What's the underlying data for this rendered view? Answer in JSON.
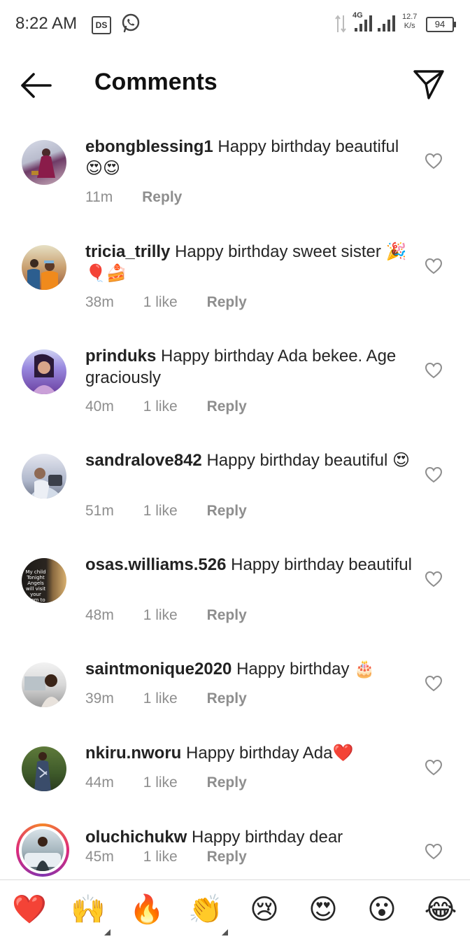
{
  "status_bar": {
    "time": "8:22 AM",
    "ds_label": "DS",
    "network": "4G",
    "speed_value": "12.7",
    "speed_unit": "K/s",
    "battery": "94"
  },
  "header": {
    "title": "Comments"
  },
  "comments": [
    {
      "username": "ebongblessing1",
      "text": "Happy birthday beautiful😍😍",
      "time": "11m",
      "likes": "",
      "reply": "Reply"
    },
    {
      "username": "tricia_trilly",
      "text": "Happy birthday sweet sister 🎉🎈🍰",
      "time": "38m",
      "likes": "1 like",
      "reply": "Reply"
    },
    {
      "username": "prinduks",
      "text": "Happy birthday Ada bekee. Age graciously",
      "time": "40m",
      "likes": "1 like",
      "reply": "Reply"
    },
    {
      "username": "sandralove842",
      "text": "Happy birthday beautiful 😍",
      "time": "51m",
      "likes": "1 like",
      "reply": "Reply"
    },
    {
      "username": "osas.williams.526",
      "text": "Happy birthday beautiful",
      "time": "48m",
      "likes": "1 like",
      "reply": "Reply"
    },
    {
      "username": "saintmonique2020",
      "text": "Happy birthday 🎂",
      "time": "39m",
      "likes": "1 like",
      "reply": "Reply"
    },
    {
      "username": "nkiru.nworu",
      "text": "Happy birthday Ada❤️",
      "time": "44m",
      "likes": "1 like",
      "reply": "Reply"
    },
    {
      "username": "oluchichukw",
      "text": "Happy birthday dear",
      "time": "45m",
      "likes": "1 like",
      "reply": "Reply"
    }
  ],
  "avatar_text": {
    "osas": "My child Tonight Angels will visit your room to bless you."
  },
  "emoji_bar": [
    "❤️",
    "🙌",
    "🔥",
    "👏",
    "😢",
    "😍",
    "😮",
    "😂"
  ],
  "colors": {
    "text": "#262626",
    "muted": "#8e8e8e",
    "story_ring": "#dd2a7b"
  }
}
